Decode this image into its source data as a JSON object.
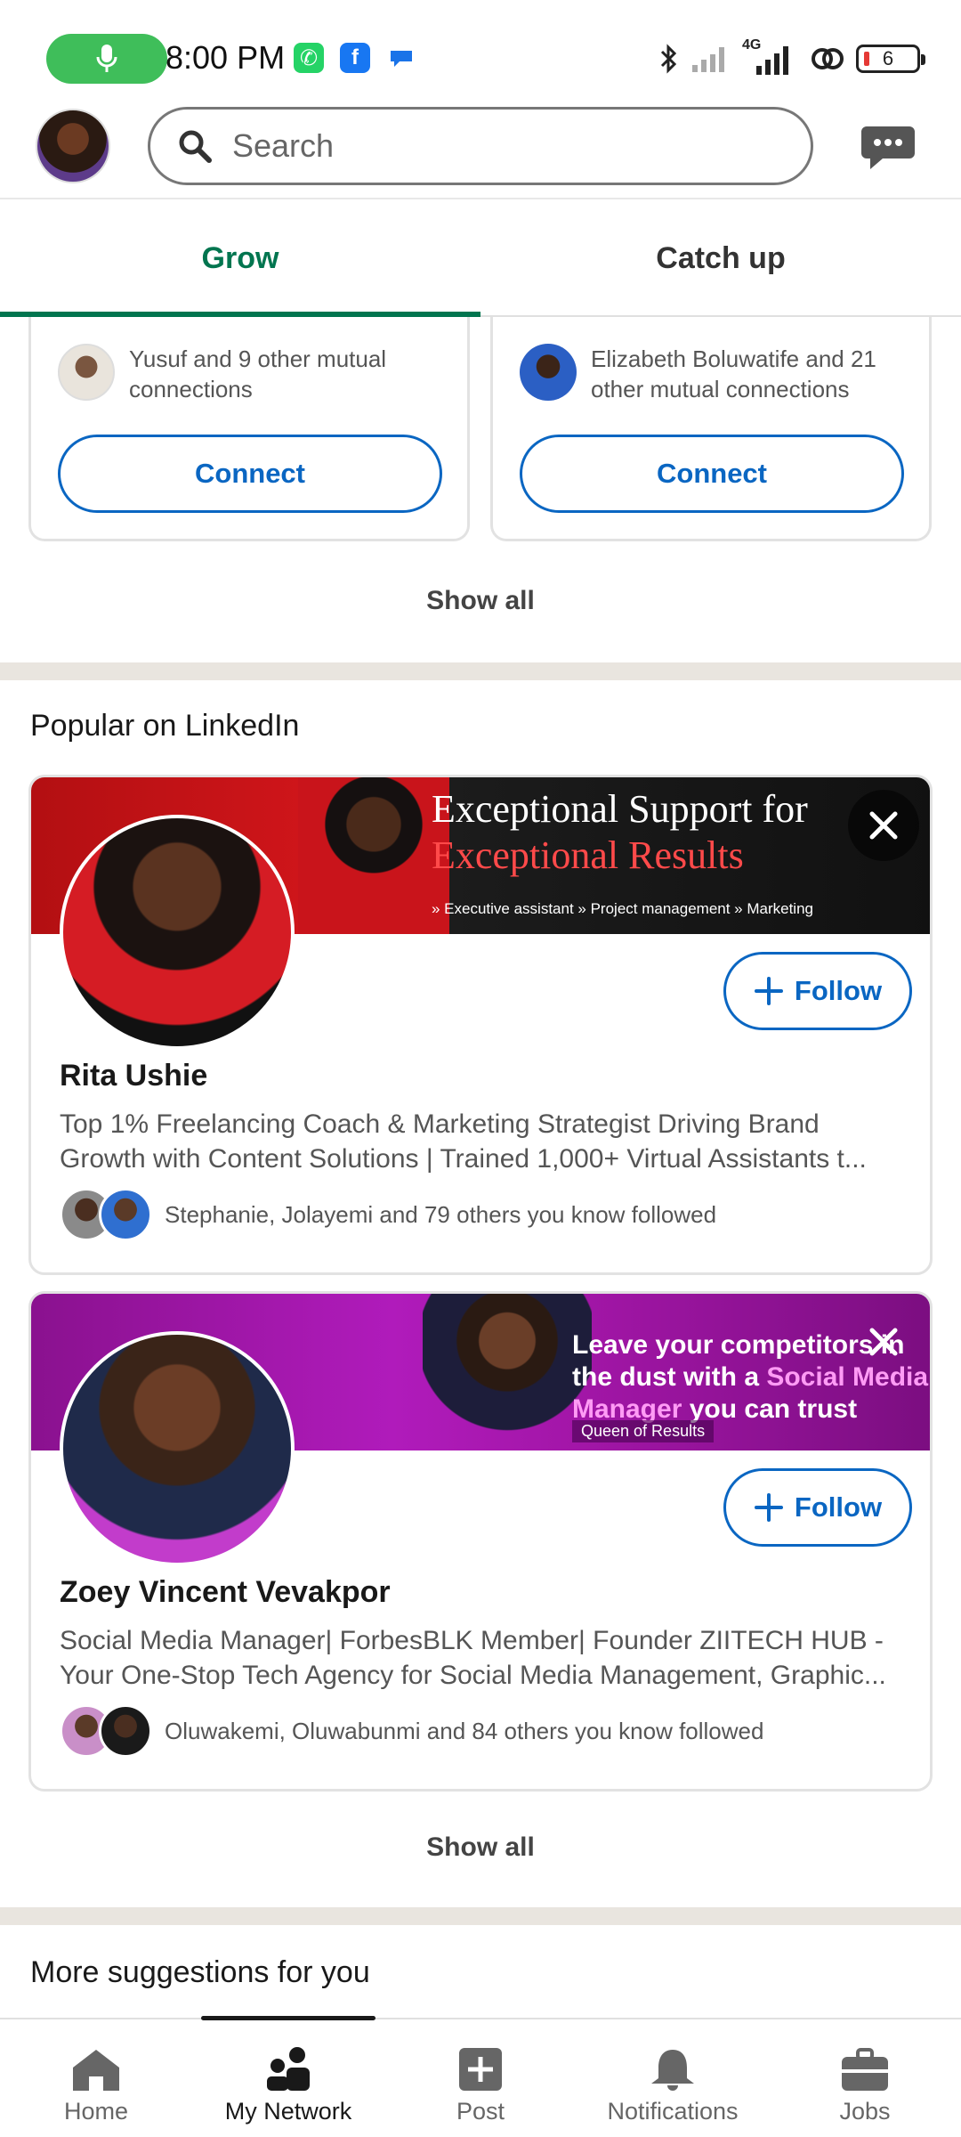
{
  "status_bar": {
    "time": "8:00 PM",
    "network": "4G",
    "battery": "6",
    "colors": {
      "mic_pill": "#3fbe5a",
      "whatsapp": "#25d366",
      "facebook": "#1877f2"
    }
  },
  "search": {
    "placeholder": "Search"
  },
  "tabs": [
    {
      "label": "Grow",
      "active": true
    },
    {
      "label": "Catch up",
      "active": false
    }
  ],
  "connection_suggestions": [
    {
      "mutual_text": "Yusuf and 9 other mutual connections",
      "button": "Connect"
    },
    {
      "mutual_text": "Elizabeth Boluwatife and 21 other mutual connections",
      "button": "Connect"
    }
  ],
  "show_all_1": "Show all",
  "popular": {
    "title": "Popular on LinkedIn",
    "cards": [
      {
        "banner_line1": "Exceptional Support for",
        "banner_line2": "Exceptional Results",
        "banner_sub": "» Executive assistant  » Project management  » Marketing",
        "name": "Rita Ushie",
        "headline_line1": "Top 1% Freelancing Coach & Marketing Strategist Driving Brand",
        "headline_line2": "Growth with Content Solutions | Trained 1,000+ Virtual Assistants t...",
        "followed_by": "Stephanie, Jolayemi and 79 others you know followed",
        "button": "Follow"
      },
      {
        "banner_line1": "Leave your competitors in",
        "banner_line2_a": "the dust with a ",
        "banner_line2_b": "Social Media",
        "banner_line3_a": "Manager",
        "banner_line3_b": " you can trust",
        "banner_sub": "Queen of Results",
        "name": "Zoey Vincent Vevakpor",
        "headline_line1": "Social Media Manager| ForbesBLK Member| Founder ZIITECH HUB -",
        "headline_line2": "Your One-Stop Tech Agency for Social Media Management, Graphic...",
        "followed_by": "Oluwakemi, Oluwabunmi and 84 others you know followed",
        "button": "Follow"
      }
    ]
  },
  "show_all_2": "Show all",
  "more_suggestions": {
    "title": "More suggestions for you"
  },
  "bottom_nav": [
    {
      "label": "Home",
      "icon": "home-icon"
    },
    {
      "label": "My Network",
      "icon": "people-icon",
      "active": true
    },
    {
      "label": "Post",
      "icon": "plus-square-icon"
    },
    {
      "label": "Notifications",
      "icon": "bell-icon"
    },
    {
      "label": "Jobs",
      "icon": "briefcase-icon"
    }
  ]
}
